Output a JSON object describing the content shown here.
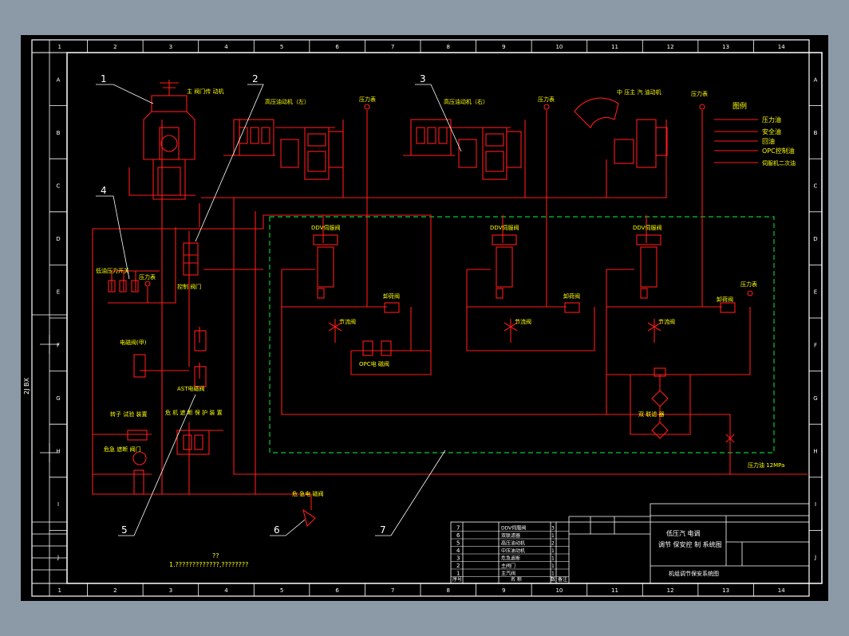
{
  "colors": {
    "background": "#8c9aa8",
    "sheet": "#000000",
    "frame": "#ffffff",
    "pipe": "#ff1a1a",
    "label": "#ffff00",
    "dashed_box": "#00cc33",
    "leader": "#ffffff"
  },
  "frame": {
    "col_numbers": [
      "1",
      "2",
      "3",
      "4",
      "5",
      "6",
      "7",
      "8",
      "9",
      "10",
      "11",
      "12",
      "13",
      "14"
    ],
    "row_letters": [
      "A",
      "B",
      "C",
      "D",
      "E",
      "F",
      "G",
      "H",
      "I",
      "J"
    ],
    "side_text": "2J  BX"
  },
  "callouts": [
    "1",
    "2",
    "3",
    "4",
    "5",
    "6",
    "7"
  ],
  "labels": {
    "main_actuator": "主 阀门传 动机",
    "hp_actuator_left": "高压油动机（左）",
    "hp_actuator_right": "高压油动机（右）",
    "mp_actuator": "中 压主 汽 油动机",
    "pressure_gauge": "压力表",
    "ddv_valve": "DDV伺服阀",
    "unload_valve": "卸荷阀",
    "throttle_valve": "节流阀",
    "control_gate": "控制 阀门",
    "pressure_switch": "低油压力开关",
    "solenoid_valve": "电磁阀(甲)",
    "ast_solenoid": "AST电磁阀",
    "opc_solenoid": "OPC电 磁阀",
    "rotor_check": "转子 试验 装置",
    "trip_device": "危急 遮断 阀门",
    "overspeed_protect": "危 机 遮 断 保 护 装 置",
    "filter": "双 联滤 器",
    "drain_solenoid": "危 急电 磁阀",
    "supply_pressure": "压力油 12MPa",
    "note_marks": "??",
    "note_text": "1.?????????????,????????"
  },
  "legend": {
    "title": "图例",
    "items": [
      "压力油",
      "安全油",
      "回油",
      "OPC控制油",
      "伺服机二次油"
    ]
  },
  "title_block": {
    "title_line1": "低压汽 电调",
    "title_line2": "调节 保安控 制 系统图",
    "drawing_name": "机组调节保安系统图",
    "bom_numbers": [
      "7",
      "6",
      "5",
      "4",
      "3",
      "2",
      "1"
    ],
    "bom_names": [
      "DDV伺服阀",
      "双联滤器",
      "高压油动机",
      "中压油动机",
      "危急遮断",
      "主阀门",
      "主汽阀"
    ],
    "bom_qty": [
      "3",
      "1",
      "2",
      "1",
      "1",
      "1",
      "1"
    ],
    "bom_header_no": "序号",
    "bom_header_name": "名 称",
    "bom_header_qty": "数",
    "bom_header_note": "备注"
  }
}
